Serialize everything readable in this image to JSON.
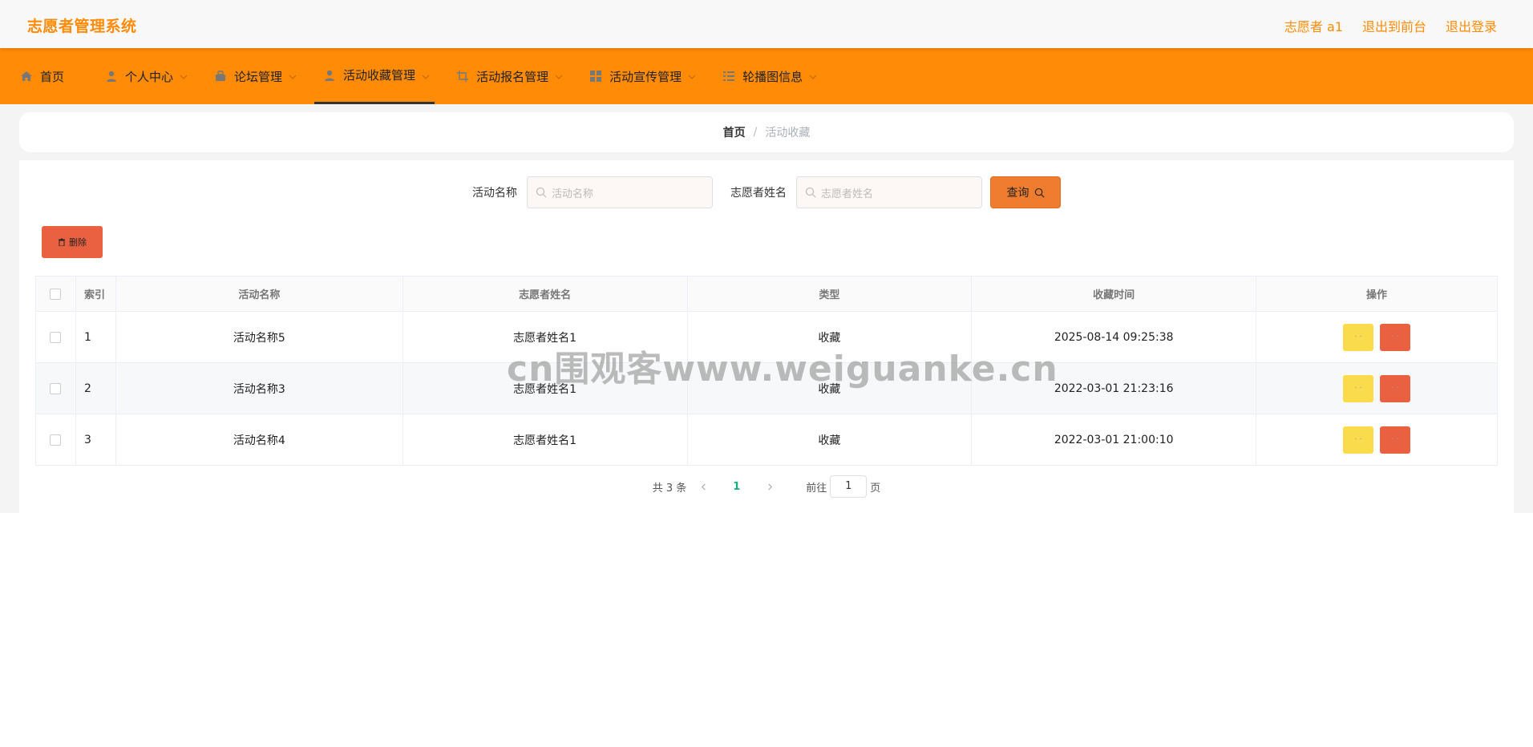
{
  "header": {
    "brand": "志愿者管理系统",
    "user": "志愿者 a1",
    "to_front": "退出到前台",
    "logout": "退出登录"
  },
  "nav": {
    "items": [
      {
        "label": "首页",
        "icon": "home-icon",
        "dropdown": false,
        "active": false
      },
      {
        "label": "个人中心",
        "icon": "user-icon",
        "dropdown": true,
        "active": false
      },
      {
        "label": "论坛管理",
        "icon": "forum-icon",
        "dropdown": true,
        "active": false
      },
      {
        "label": "活动收藏管理",
        "icon": "user-icon",
        "dropdown": true,
        "active": true
      },
      {
        "label": "活动报名管理",
        "icon": "crop-icon",
        "dropdown": true,
        "active": false
      },
      {
        "label": "活动宣传管理",
        "icon": "grid-icon",
        "dropdown": true,
        "active": false
      },
      {
        "label": "轮播图信息",
        "icon": "list-icon",
        "dropdown": true,
        "active": false
      }
    ]
  },
  "breadcrumb": {
    "home": "首页",
    "separator": "/",
    "current": "活动收藏"
  },
  "search": {
    "activity_label": "活动名称",
    "activity_placeholder": "活动名称",
    "volunteer_label": "志愿者姓名",
    "volunteer_placeholder": "志愿者姓名",
    "query_label": "查询"
  },
  "actions": {
    "delete_label": "删除"
  },
  "table": {
    "columns": [
      "索引",
      "活动名称",
      "志愿者姓名",
      "类型",
      "收藏时间",
      "操作"
    ],
    "rows": [
      {
        "index": "1",
        "activity": "活动名称5",
        "volunteer": "志愿者姓名1",
        "type": "收藏",
        "time": "2025-08-14 09:25:38"
      },
      {
        "index": "2",
        "activity": "活动名称3",
        "volunteer": "志愿者姓名1",
        "type": "收藏",
        "time": "2022-03-01 21:23:16"
      },
      {
        "index": "3",
        "activity": "活动名称4",
        "volunteer": "志愿者姓名1",
        "type": "收藏",
        "time": "2022-03-01 21:00:10"
      }
    ],
    "op_edit_label": "· ·",
    "op_delete_label": "· ·"
  },
  "pagination": {
    "total": "共 3 条",
    "current_page": "1",
    "goto_label": "前往",
    "goto_value": "1",
    "page_suffix": "页"
  },
  "watermark": "cn围观客www.weiguanke.cn",
  "colors": {
    "accent": "#ff8b07",
    "query_button": "#f07d2f",
    "delete_button": "#ea6141",
    "edit_button": "#fadb4b",
    "active_page": "#18b07a"
  }
}
